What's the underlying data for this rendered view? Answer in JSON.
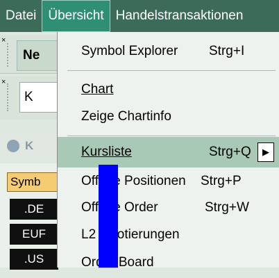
{
  "menubar": {
    "items": [
      {
        "label": "Datei"
      },
      {
        "label": "Übersicht"
      },
      {
        "label": "Handelstransaktionen"
      }
    ]
  },
  "left": {
    "toolbar_button": "Ne",
    "field_text": "K",
    "panel_title": "K",
    "symbol_header": "Symb",
    "rows": [
      ".DE",
      "EUF",
      ".US"
    ]
  },
  "menu": {
    "items": [
      {
        "label": "Symbol Explorer",
        "shortcut": "Strg+I"
      },
      {
        "label": "Chart",
        "shortcut": ""
      },
      {
        "label": "Zeige Chartinfo",
        "shortcut": ""
      },
      {
        "label": "Kursliste",
        "shortcut": "Strg+Q"
      },
      {
        "label": "Offene Positionen",
        "shortcut": "Strg+P"
      },
      {
        "label": "Offene Order",
        "shortcut": "Strg+W"
      },
      {
        "label": "L2 Quotierungen",
        "shortcut": ""
      },
      {
        "label": "Order Board",
        "shortcut": ""
      }
    ],
    "submenu_arrow_icon": "triangle-right-icon",
    "highlight_color": "#a8c9b5"
  }
}
